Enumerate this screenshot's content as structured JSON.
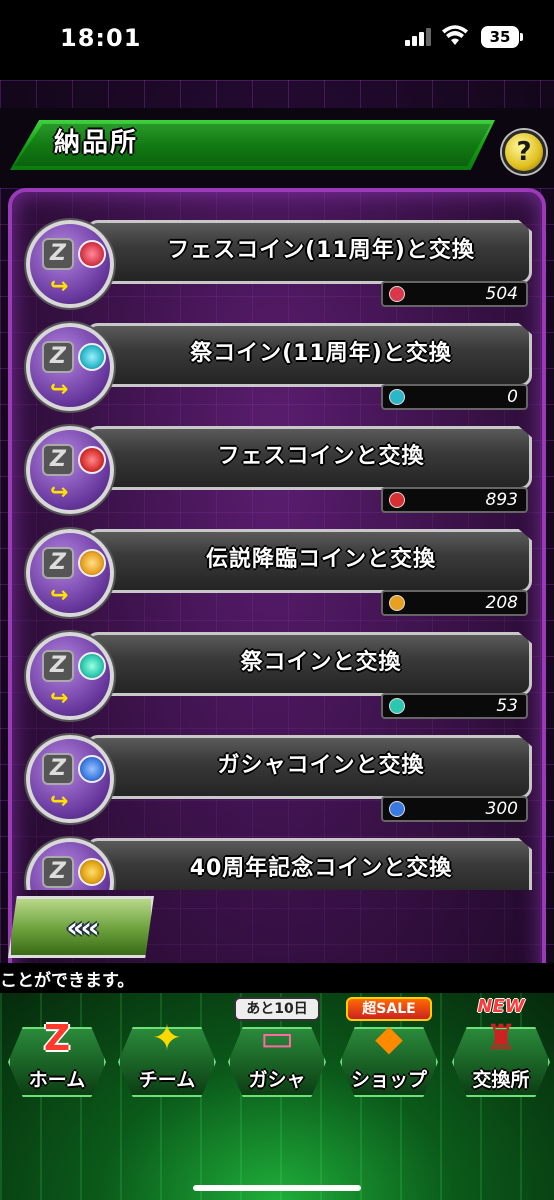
{
  "status_bar": {
    "time": "18:01",
    "battery": "35"
  },
  "header": {
    "title": "納品所",
    "help_symbol": "?"
  },
  "exchanges": [
    {
      "label": "フェスコイン(11周年)と交換",
      "count": "504",
      "coin_color": "#d8384a"
    },
    {
      "label": "祭コイン(11周年)と交換",
      "count": "0",
      "coin_color": "#2ab8c8"
    },
    {
      "label": "フェスコインと交換",
      "count": "893",
      "coin_color": "#d83030"
    },
    {
      "label": "伝説降臨コインと交換",
      "count": "208",
      "coin_color": "#e8a020"
    },
    {
      "label": "祭コインと交換",
      "count": "53",
      "coin_color": "#2ac8b0"
    },
    {
      "label": "ガシャコインと交換",
      "count": "300",
      "coin_color": "#3a7ae0"
    },
    {
      "label": "40周年記念コインと交換",
      "count": "",
      "coin_color": "#e0a010"
    }
  ],
  "back_button": {
    "label": "«‹‹"
  },
  "tip": {
    "text": "ことができます。"
  },
  "nav": [
    {
      "label": "ホーム",
      "icon": "Z",
      "tag": ""
    },
    {
      "label": "チーム",
      "icon": "✦",
      "tag": ""
    },
    {
      "label": "ガシャ",
      "icon": "▭",
      "tag": "あと10日"
    },
    {
      "label": "ショップ",
      "icon": "◆",
      "tag": "超SALE"
    },
    {
      "label": "交換所",
      "icon": "♜",
      "tag": "NEW"
    }
  ]
}
